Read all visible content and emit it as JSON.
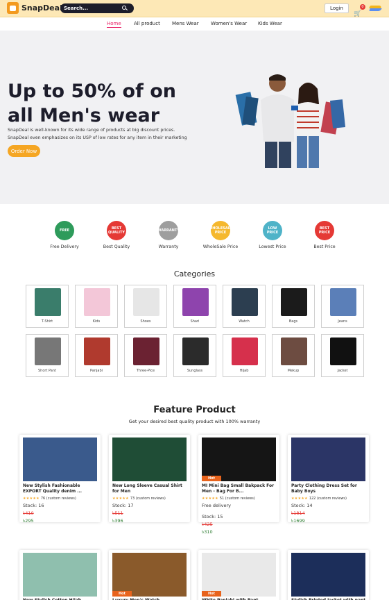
{
  "header": {
    "brand": "SnapDeal",
    "search_placeholder": "Search...",
    "login_label": "Login",
    "cart_count": "0"
  },
  "nav": [
    "Home",
    "All product",
    "Mens Wear",
    "Women's Wear",
    "Kids Wear"
  ],
  "hero": {
    "title": "Up to 50% of on all Men's wear",
    "description_line1": "SnapDeal is well-known for its wide range of products at big discount prices.",
    "description_line2": "SnapDeal even emphasizes on its USP of low rates for any item in their marketing",
    "cta": "Order Now"
  },
  "features": [
    {
      "label": "Free Delivery",
      "icon": "free-delivery-icon",
      "badge": "FREE",
      "color": "#2e9b5b"
    },
    {
      "label": "Best Quality",
      "icon": "best-quality-icon",
      "badge": "BEST QUALITY",
      "color": "#e53935"
    },
    {
      "label": "Warranty",
      "icon": "warranty-icon",
      "badge": "WARRANTY",
      "color": "#9e9e9e"
    },
    {
      "label": "WholeSale Price",
      "icon": "wholesale-price-icon",
      "badge": "WHOLESALE PRICE",
      "color": "#f5b82e"
    },
    {
      "label": "Lowest Price",
      "icon": "lowest-price-icon",
      "badge": "LOW PRICE",
      "color": "#4fb3c8"
    },
    {
      "label": "Best Price",
      "icon": "best-price-icon",
      "badge": "BEST PRICE",
      "color": "#e53935"
    }
  ],
  "categories": {
    "title": "Categories",
    "items": [
      {
        "label": "T-Shirt",
        "color": "#3a7d6b"
      },
      {
        "label": "Kids",
        "color": "#f3c7d8"
      },
      {
        "label": "Shoes",
        "color": "#e6e6e6"
      },
      {
        "label": "Shari",
        "color": "#8e44ad"
      },
      {
        "label": "Watch",
        "color": "#2c3e50"
      },
      {
        "label": "Bags",
        "color": "#1b1b1b"
      },
      {
        "label": "Jeans",
        "color": "#5b7fb8"
      },
      {
        "label": "Short Pant",
        "color": "#777777"
      },
      {
        "label": "Panjabi",
        "color": "#b03a2e"
      },
      {
        "label": "Three-Pice",
        "color": "#6b2232"
      },
      {
        "label": "Sunglass",
        "color": "#2b2b2b"
      },
      {
        "label": "Hijab",
        "color": "#d6304c"
      },
      {
        "label": "Mekup",
        "color": "#6d4c41"
      },
      {
        "label": "Jacket",
        "color": "#111111"
      }
    ]
  },
  "featured": {
    "title": "Feature Product",
    "subtitle": "Get your desired best quality product with 100% warranty",
    "products": [
      {
        "title": "New Stylish Fashionable EXPORT Quality denim ...",
        "rating": "76 (custom reviews)",
        "stock": "Stock: 16",
        "extra": "",
        "old_price": "৳410",
        "new_price": "৳295",
        "hot": "",
        "color": "#3a5a8c"
      },
      {
        "title": "New Long Sleeve Casual Shirt for Men",
        "rating": "73 (custom reviews)",
        "stock": "Stock: 17",
        "extra": "",
        "old_price": "৳511",
        "new_price": "৳396",
        "hot": "",
        "color": "#1f4d36"
      },
      {
        "title": "MI Mini Bag Small Bakpack For Men - Bag For B...",
        "rating": "51 (custom reviews)",
        "stock": "Stock: 15",
        "extra": "Free delivery",
        "old_price": "৳425",
        "new_price": "৳310",
        "hot": "Hot",
        "color": "#151515"
      },
      {
        "title": "Party Clothing Dress Set for Baby Boys",
        "rating": "122 (custom reviews)",
        "stock": "Stock: 14",
        "extra": "",
        "old_price": "৳1814",
        "new_price": "৳1699",
        "hot": "",
        "color": "#2b3566"
      }
    ],
    "more": [
      {
        "title": "New Stylish Cotton Hijab",
        "hot": "",
        "color": "#8fbfae"
      },
      {
        "title": "Luxury Men's Watch",
        "hot": "Hot",
        "color": "#8a5a2b"
      },
      {
        "title": "White Panjabi with Pant",
        "hot": "Hot",
        "color": "#e9e9e9"
      },
      {
        "title": "Stylish Printed Jacket with pant",
        "hot": "",
        "color": "#1c2e5a"
      }
    ]
  }
}
